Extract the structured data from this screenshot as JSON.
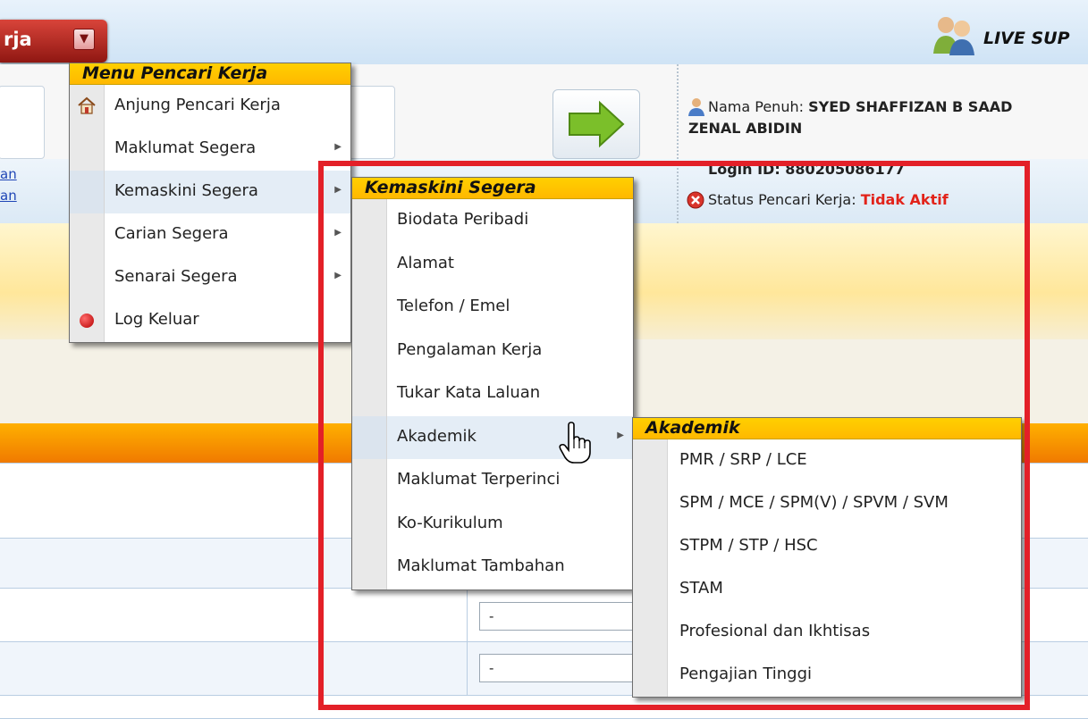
{
  "header": {
    "menu_button_label": "rja",
    "live_support": "LIVE SUP"
  },
  "background": {
    "left_link_1": "an",
    "left_link_2": "an",
    "name_label": "Nama Penuh: ",
    "name_value_line1": "SYED SHAFFIZAN B SAAD",
    "name_value_line2": "ZENAL ABIDIN",
    "login_line": "Login ID: 880205086177",
    "status_label": "Status Pencari Kerja: ",
    "status_value": "Tidak Aktif",
    "select_1_value": "-",
    "select_2_value": "-"
  },
  "menu1": {
    "title": "Menu Pencari Kerja",
    "items": [
      {
        "label": "Anjung Pencari Kerja",
        "icon": "home-icon"
      },
      {
        "label": "Maklumat Segera"
      },
      {
        "label": "Kemaskini Segera"
      },
      {
        "label": "Carian Segera"
      },
      {
        "label": "Senarai Segera"
      },
      {
        "label": "Log Keluar",
        "icon": "red-dot-icon"
      }
    ]
  },
  "menu2": {
    "title": "Kemaskini Segera",
    "items": [
      {
        "label": "Biodata Peribadi"
      },
      {
        "label": "Alamat"
      },
      {
        "label": "Telefon / Emel"
      },
      {
        "label": "Pengalaman Kerja"
      },
      {
        "label": "Tukar Kata Laluan"
      },
      {
        "label": "Akademik"
      },
      {
        "label": "Maklumat Terperinci"
      },
      {
        "label": "Ko-Kurikulum"
      },
      {
        "label": "Maklumat Tambahan"
      }
    ]
  },
  "menu3": {
    "title": "Akademik",
    "items": [
      {
        "label": "PMR / SRP / LCE"
      },
      {
        "label": "SPM / MCE / SPM(V) / SPVM / SVM"
      },
      {
        "label": "STPM / STP / HSC"
      },
      {
        "label": "STAM"
      },
      {
        "label": "Profesional dan Ikhtisas"
      },
      {
        "label": "Pengajian Tinggi"
      }
    ]
  },
  "colors": {
    "menu_title_bg": "#ffc800",
    "highlight_box": "#e32028",
    "status_inactive": "#e2231a",
    "menu_button": "#b02a20"
  }
}
